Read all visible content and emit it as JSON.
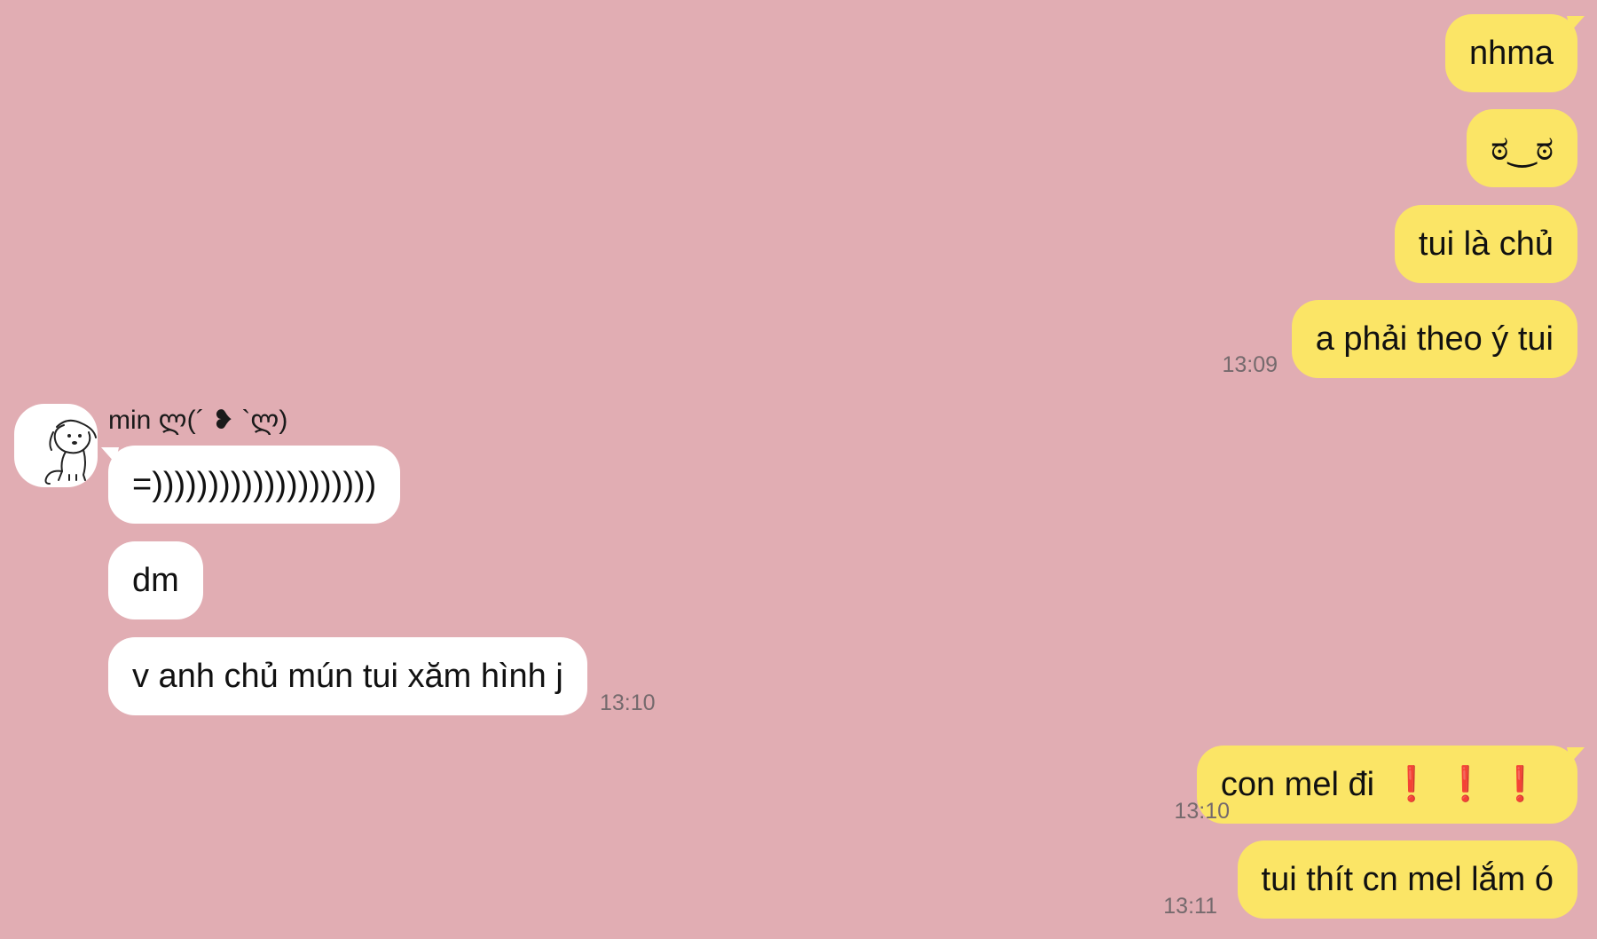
{
  "contact": {
    "name": "min ლ(´ ❥ `ლ)",
    "avatar_icon": "dog-doodle-icon"
  },
  "messages": [
    {
      "side": "out",
      "text": "nhma"
    },
    {
      "side": "out",
      "text": "ಠ‿ಠ"
    },
    {
      "side": "out",
      "text": "tui là chủ"
    },
    {
      "side": "out",
      "text": "a phải theo ý tui",
      "time": "13:09"
    },
    {
      "side": "in",
      "text": "=))))))))))))))))))))"
    },
    {
      "side": "in",
      "text": "dm"
    },
    {
      "side": "in",
      "text": "v anh chủ mún tui xăm hình j",
      "time": "13:10"
    },
    {
      "side": "out",
      "text": "con mel đi",
      "emoji": "❗❗❗",
      "time": "13:10"
    },
    {
      "side": "out",
      "text": "tui thít cn mel lắm ó",
      "time": "13:11"
    }
  ],
  "colors": {
    "background": "#e1adb3",
    "outgoing_bubble": "#fbe566",
    "incoming_bubble": "#ffffff",
    "timestamp": "#756a6d",
    "emoji_accent": "#e8412e"
  }
}
